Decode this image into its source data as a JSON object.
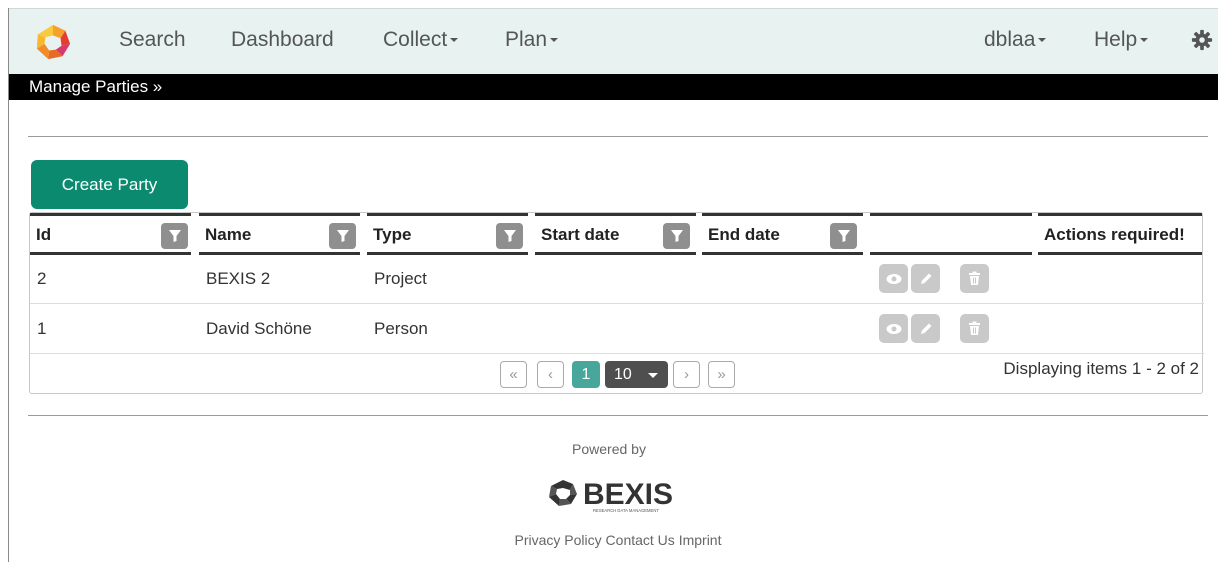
{
  "nav": {
    "search": "Search",
    "dashboard": "Dashboard",
    "collect": "Collect",
    "plan": "Plan",
    "user": "dblaa",
    "help": "Help"
  },
  "subbar": {
    "label": "Manage Parties »"
  },
  "create_button": "Create Party",
  "table": {
    "columns": [
      "Id",
      "Name",
      "Type",
      "Start date",
      "End date",
      "",
      "Actions required!"
    ],
    "rows": [
      {
        "id": "2",
        "name": "BEXIS 2",
        "type": "Project",
        "start": "",
        "end": ""
      },
      {
        "id": "1",
        "name": "David Schöne",
        "type": "Person",
        "start": "",
        "end": ""
      }
    ]
  },
  "pager": {
    "first": "«",
    "prev": "‹",
    "current": "1",
    "page_size": "10",
    "next": "›",
    "last": "»",
    "info": "Displaying items 1 - 2 of 2"
  },
  "footer": {
    "powered": "Powered by",
    "brand": "BEXIS",
    "brand_sub": "RESEARCH DATA MANAGEMENT",
    "links": [
      "Privacy Policy",
      "Contact Us",
      "Imprint"
    ]
  },
  "colors": {
    "accent": "#0b8a70",
    "nav_bg": "#e7f2f1",
    "pager_active": "#47a79a"
  }
}
